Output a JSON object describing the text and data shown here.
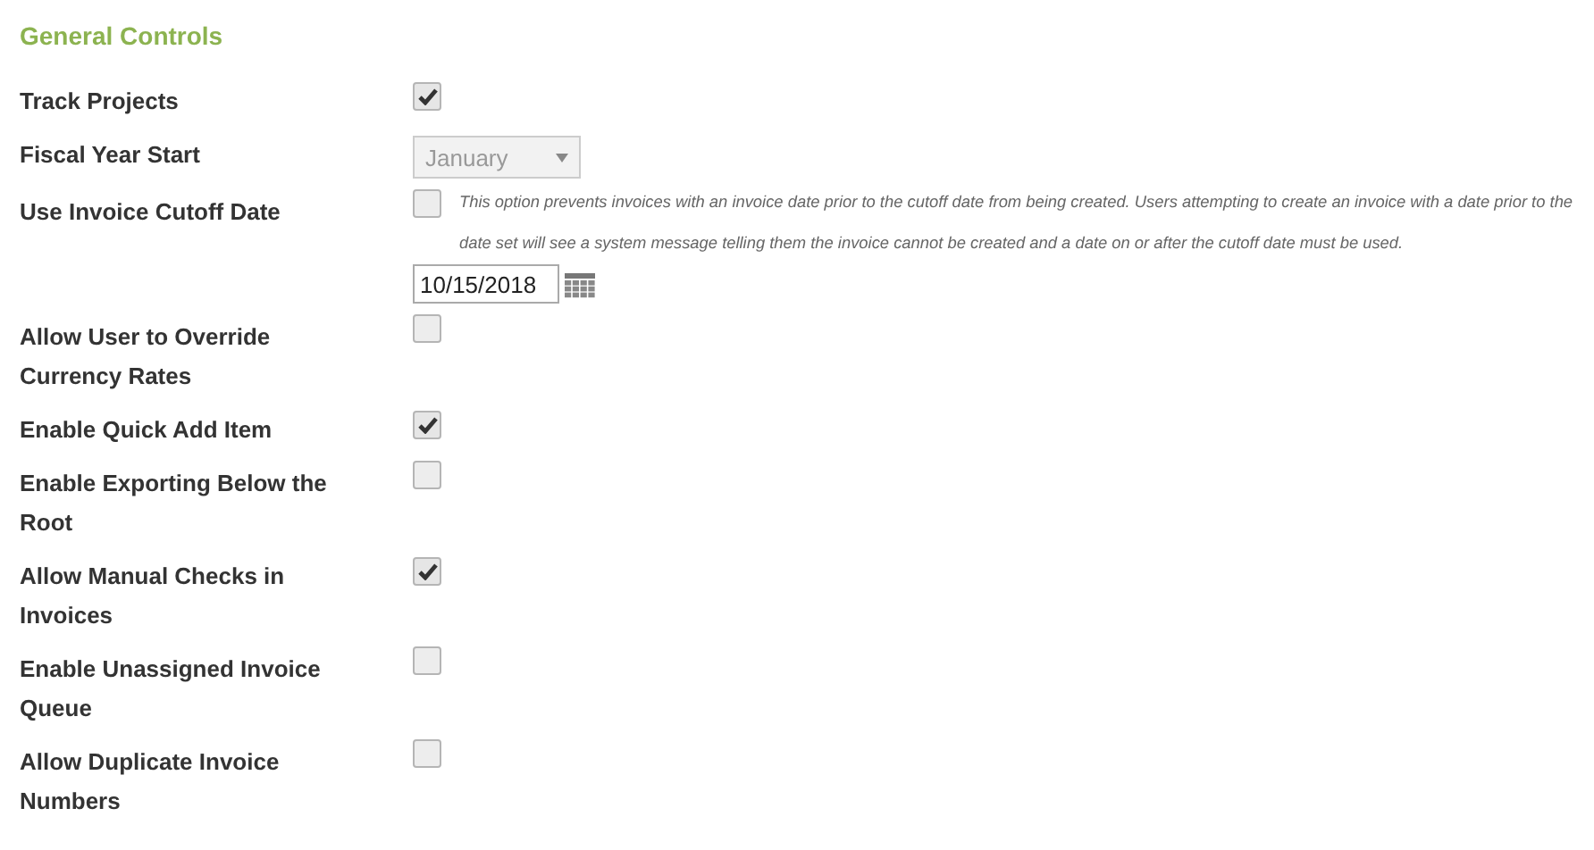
{
  "heading": "General Controls",
  "settings": [
    {
      "kind": "checkbox",
      "label": "Track Projects",
      "checked": true
    },
    {
      "kind": "select",
      "label": "Fiscal Year Start",
      "value": "January",
      "disabled": true
    },
    {
      "kind": "cutoff",
      "label": "Use Invoice Cutoff Date",
      "checked": false,
      "note": "This option prevents invoices with an invoice date prior to the cutoff date from being created. Users attempting to create an invoice with a date prior to the date set will see a system message telling them the invoice cannot be created and a date on or after the cutoff date must be used.",
      "date": "10/15/2018"
    },
    {
      "kind": "checkbox",
      "label": "Allow User to Override Currency Rates",
      "checked": false
    },
    {
      "kind": "checkbox",
      "label": "Enable Quick Add Item",
      "checked": true
    },
    {
      "kind": "checkbox",
      "label": "Enable Exporting Below the Root",
      "checked": false
    },
    {
      "kind": "checkbox",
      "label": "Allow Manual Checks in Invoices",
      "checked": true
    },
    {
      "kind": "checkbox",
      "label": "Enable Unassigned Invoice Queue",
      "checked": false
    },
    {
      "kind": "checkbox",
      "label": "Allow Duplicate Invoice Numbers",
      "checked": false
    }
  ]
}
